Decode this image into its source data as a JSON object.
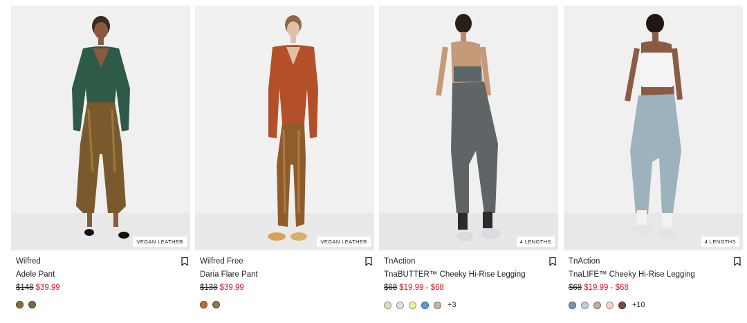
{
  "products": [
    {
      "brand": "Wilfred",
      "name": "Adele Pant",
      "was_price": "$148",
      "price": "$39.99",
      "tag": "VEGAN LEATHER",
      "swatches": [
        "#8a6a3e",
        "#7b6a45"
      ],
      "more": ""
    },
    {
      "brand": "Wilfred Free",
      "name": "Daria Flare Pant",
      "was_price": "$138",
      "price": "$39.99",
      "tag": "VEGAN LEATHER",
      "swatches": [
        "#b46f36",
        "#8a7a4e"
      ],
      "more": ""
    },
    {
      "brand": "TnAction",
      "name": "TnaBUTTER™ Cheeky Hi-Rise Legging",
      "was_price": "$68",
      "price": "$19.99 - $68",
      "tag": "4 LENGTHS",
      "swatches": [
        "#cfe3c4",
        "#dde0e0",
        "#eef0a0",
        "#5b9be0",
        "#c8b6a0"
      ],
      "more": "+3"
    },
    {
      "brand": "TnAction",
      "name": "TnaLIFE™ Cheeky Hi-Rise Legging",
      "was_price": "$68",
      "price": "$19.99 - $68",
      "tag": "4 LENGTHS",
      "swatches": [
        "#7f93a5",
        "#b9d2e2",
        "#c5ad94",
        "#efd4d0",
        "#7a4a3a"
      ],
      "more": "+10"
    }
  ],
  "icons": {
    "bookmark": "bookmark-icon"
  },
  "colors": {
    "sale": "#d01b2a",
    "text": "#222222",
    "photo_bg": "#efefef"
  }
}
